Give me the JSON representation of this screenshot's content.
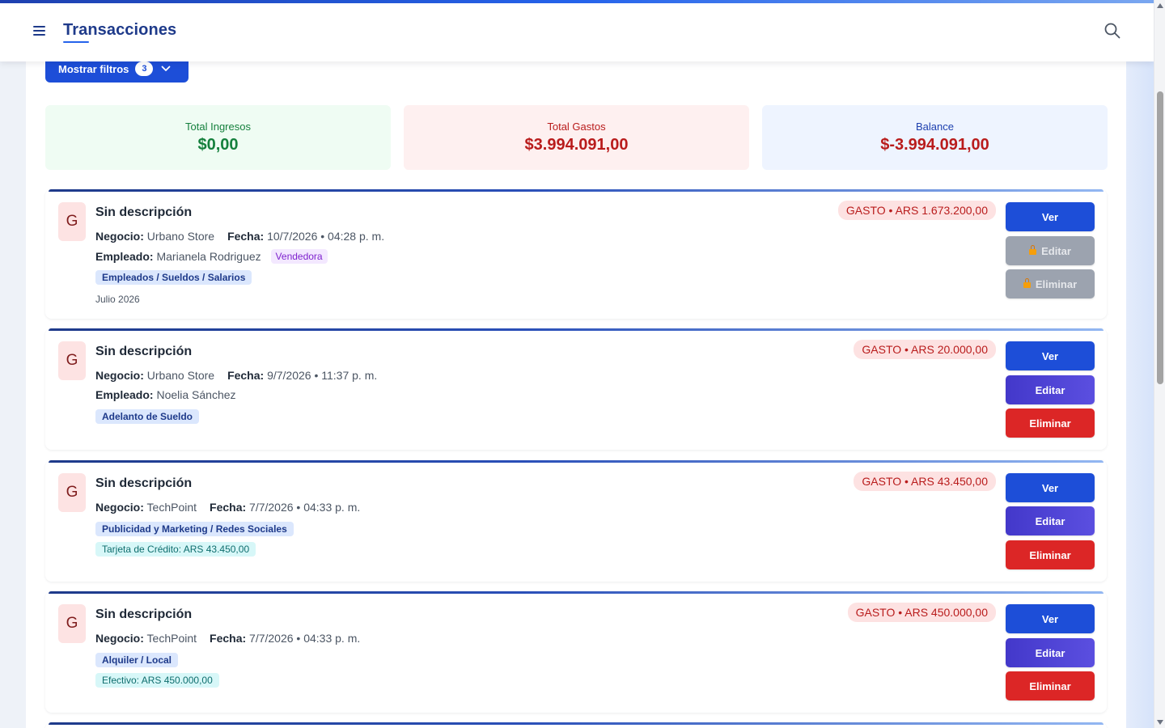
{
  "header": {
    "title": "Transacciones"
  },
  "filters": {
    "label": "Mostrar filtros",
    "count": "3"
  },
  "summary": {
    "income": {
      "label": "Total Ingresos",
      "value": "$0,00"
    },
    "expense": {
      "label": "Total Gastos",
      "value": "$3.994.091,00"
    },
    "balance": {
      "label": "Balance",
      "value": "$-3.994.091,00"
    }
  },
  "labels": {
    "negocio": "Negocio:",
    "fecha": "Fecha:",
    "empleado": "Empleado:",
    "ver": "Ver",
    "editar": "Editar",
    "eliminar": "Eliminar"
  },
  "transactions": [
    {
      "avatar": "G",
      "description": "Sin descripción",
      "amount": "GASTO • ARS 1.673.200,00",
      "business": "Urbano Store",
      "date": "10/7/2026 • 04:28 p. m.",
      "employee": "Marianela Rodriguez",
      "role": "Vendedora",
      "category": "Empleados / Sueldos / Salarios",
      "month": "Julio 2026",
      "locked": true
    },
    {
      "avatar": "G",
      "description": "Sin descripción",
      "amount": "GASTO • ARS 20.000,00",
      "business": "Urbano Store",
      "date": "9/7/2026 • 11:37 p. m.",
      "employee": "Noelia Sánchez",
      "category": "Adelanto de Sueldo"
    },
    {
      "avatar": "G",
      "description": "Sin descripción",
      "amount": "GASTO • ARS 43.450,00",
      "business": "TechPoint",
      "date": "7/7/2026 • 04:33 p. m.",
      "category": "Publicidad y Marketing / Redes Sociales",
      "payment": "Tarjeta de Crédito: ARS 43.450,00"
    },
    {
      "avatar": "G",
      "description": "Sin descripción",
      "amount": "GASTO • ARS 450.000,00",
      "business": "TechPoint",
      "date": "7/7/2026 • 04:33 p. m.",
      "category": "Alquiler / Local",
      "payment": "Efectivo: ARS 450.000,00"
    }
  ],
  "icons": {
    "menu": "hamburger-menu-icon",
    "search": "search-icon",
    "chevron": "chevron-down-icon",
    "lock": "lock-icon"
  },
  "colors": {
    "primary": "#1d4ed8",
    "edit": "#4f46e5",
    "danger": "#dc2626",
    "income": "#15803d",
    "expense": "#b91c1c"
  }
}
